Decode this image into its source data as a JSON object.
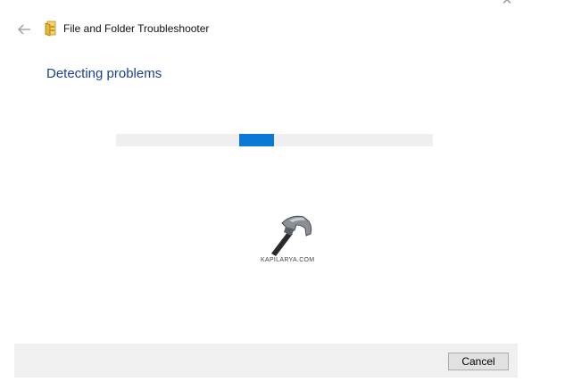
{
  "window": {
    "title": "File and Folder Troubleshooter",
    "close_glyph": "✕",
    "back_icon": "back-arrow-icon",
    "app_icon": "folder-troubleshooter-icon"
  },
  "main": {
    "heading": "Detecting problems",
    "progress": {
      "mode": "indeterminate",
      "chunk_start_fraction": 0.389,
      "chunk_width_fraction": 0.11,
      "track_color": "#efefef",
      "fill_color": "#0a78d6"
    },
    "watermark": {
      "icon": "hammer-icon",
      "text": "KAPILARYA.COM"
    }
  },
  "footer": {
    "cancel_label": "Cancel"
  },
  "colors": {
    "heading": "#1d3f8f",
    "footer_bg": "#f0f0f0",
    "accent": "#0a78d6"
  }
}
